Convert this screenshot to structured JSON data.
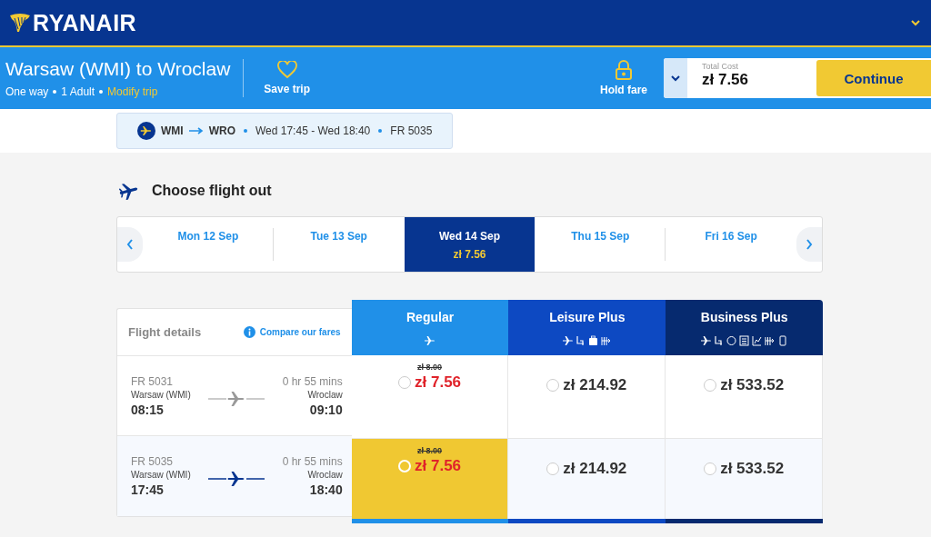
{
  "header": {
    "brand": "RYANAIR"
  },
  "trip": {
    "title": "Warsaw (WMI) to Wroclaw",
    "type": "One way",
    "passengers": "1 Adult",
    "modify": "Modify trip",
    "save": "Save trip",
    "hold": "Hold fare",
    "total_label": "Total Cost",
    "total": "zł 7.56",
    "continue": "Continue"
  },
  "summary": {
    "from": "WMI",
    "to": "WRO",
    "times": "Wed 17:45 - Wed 18:40",
    "flight": "FR 5035"
  },
  "heading": "Choose flight out",
  "dates": [
    {
      "label": "Mon 12 Sep",
      "selected": false
    },
    {
      "label": "Tue 13 Sep",
      "selected": false
    },
    {
      "label": "Wed 14 Sep",
      "price": "zł 7.56",
      "selected": true
    },
    {
      "label": "Thu 15 Sep",
      "selected": false
    },
    {
      "label": "Fri 16 Sep",
      "selected": false
    }
  ],
  "table": {
    "details_label": "Flight details",
    "compare": "Compare our fares",
    "fare_types": [
      {
        "name": "Regular",
        "color": "#2090e8"
      },
      {
        "name": "Leisure Plus",
        "color": "#0d49c2"
      },
      {
        "name": "Business Plus",
        "color": "#062a6f"
      }
    ],
    "flights": [
      {
        "number": "FR 5031",
        "from": "Warsaw (WMI)",
        "dep": "08:15",
        "duration": "0 hr 55 mins",
        "to": "Wroclaw",
        "arr": "09:10",
        "selected": false,
        "fares": [
          {
            "old": "zł 8.00",
            "price": "zł 7.56",
            "selected": false
          },
          {
            "price": "zł 214.92",
            "selected": false
          },
          {
            "price": "zł 533.52",
            "selected": false
          }
        ]
      },
      {
        "number": "FR 5035",
        "from": "Warsaw (WMI)",
        "dep": "17:45",
        "duration": "0 hr 55 mins",
        "to": "Wroclaw",
        "arr": "18:40",
        "selected": true,
        "fares": [
          {
            "old": "zł 8.00",
            "price": "zł 7.56",
            "selected": true
          },
          {
            "price": "zł 214.92",
            "selected": false
          },
          {
            "price": "zł 533.52",
            "selected": false
          }
        ]
      }
    ]
  }
}
